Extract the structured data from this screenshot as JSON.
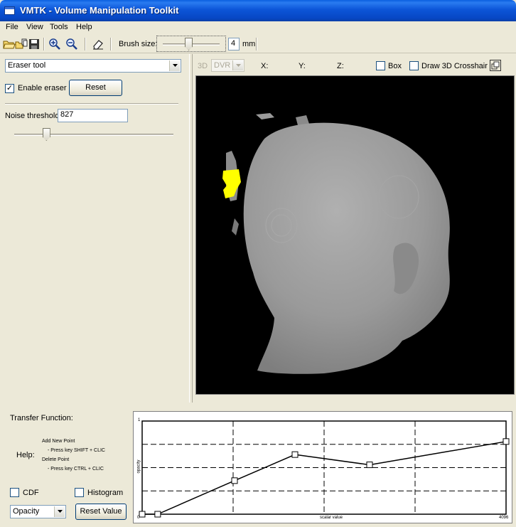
{
  "window": {
    "title": "VMTK - Volume Manipulation Toolkit"
  },
  "menu": [
    "File",
    "View",
    "Tools",
    "Help"
  ],
  "toolbar": {
    "icons": [
      "open-folder-icon",
      "open-series-icon",
      "save-icon",
      "zoom-in-icon",
      "zoom-out-icon",
      "eraser-icon"
    ],
    "brush_label": "Brush size:",
    "brush_value": "4",
    "brush_unit": "mm"
  },
  "left_panel": {
    "tool_select": "Eraser tool",
    "enable_eraser_label": "Enable eraser",
    "enable_eraser_checked": true,
    "reset_label": "Reset",
    "noise_label": "Noise threshold",
    "noise_value": "827",
    "noise_slider_fraction": 0.2
  },
  "view_toolbar": {
    "mode_3d": "3D",
    "render_mode": "DVR",
    "x_label": "X:",
    "y_label": "Y:",
    "z_label": "Z:",
    "box_label": "Box",
    "crosshair_label": "Draw 3D Crosshair"
  },
  "transfer": {
    "title": "Transfer Function:",
    "help_label": "Help:",
    "help_lines": [
      "Add New Point",
      "- Press key SHIFT + CLIC",
      "Delete Point",
      "- Press key CTRL + CLIC"
    ],
    "cdf_label": "CDF",
    "histogram_label": "Histogram",
    "function_select": "Opacity",
    "reset_value_label": "Reset Value",
    "y_axis_label": "opacity",
    "x_axis_label": "scalar value",
    "y_max": "1",
    "x_min": "0",
    "x_max": "4096",
    "points": [
      [
        0,
        0
      ],
      [
        175,
        0
      ],
      [
        1040,
        0.36
      ],
      [
        1720,
        0.64
      ],
      [
        2560,
        0.53
      ],
      [
        4096,
        0.78
      ]
    ]
  },
  "colors": {
    "highlight": "#ffff00",
    "viewport_bg": "#000000",
    "head": "#9a9a9a"
  }
}
